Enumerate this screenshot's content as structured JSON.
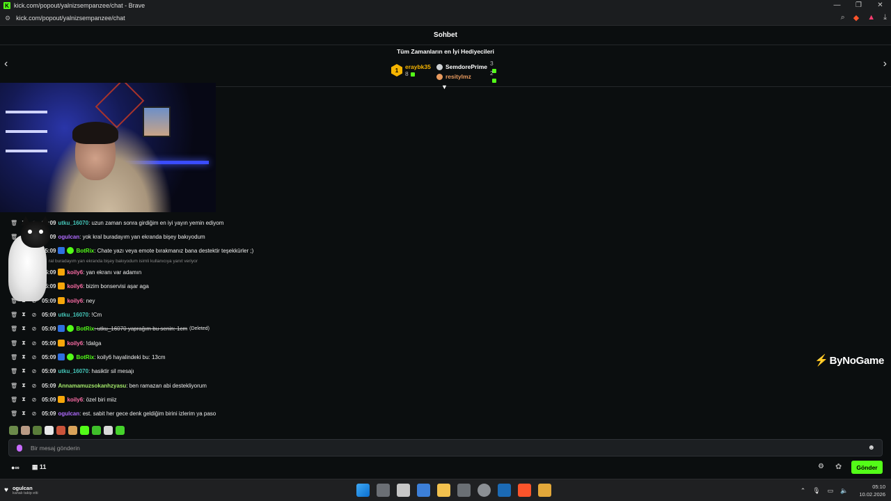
{
  "browser": {
    "title": "kick.com/popout/yalnizsempanzee/chat - Brave",
    "url": "kick.com/popout/yalnizsempanzee/chat"
  },
  "chat": {
    "header": "Sohbet",
    "gifters_title": "Tüm Zamanların en İyi Hediyecileri",
    "gifters": [
      {
        "rank": "1",
        "name": "eraybk35",
        "count": "8"
      },
      {
        "name": "SemdorePrime",
        "count": "3"
      },
      {
        "name": "resitylmz",
        "count": "2"
      }
    ],
    "reply_text": "ral buradayım yan ekranda bişey bakıyodum isimli kullanıcıya yanıt veriyor",
    "messages": [
      {
        "time": "05:09",
        "user": "utku_16070",
        "text": ": uzun zaman sonra girdiğim en iyi yayın yemin ediyom"
      },
      {
        "time": "05:09",
        "user": "ogulcan",
        "text": ": yok kral buradayım yan ekranda bişey bakıyodum"
      },
      {
        "time": "05:09",
        "user": "BotRix",
        "text": ": Chate yazı veya emote bırakmanız bana destektir teşekkürler ;)"
      },
      {
        "time": "05:09",
        "user": "koily6",
        "text": ": yan ekranı var adamın"
      },
      {
        "time": "05:09",
        "user": "koily6",
        "text": ": bizim bonservisi aşar aga"
      },
      {
        "time": "05:09",
        "user": "koily6",
        "text": ": ney"
      },
      {
        "time": "05:09",
        "user": "utku_16070",
        "text": ": !Cm"
      },
      {
        "time": "05:09",
        "user": "BotRix",
        "text": ": utku_16070 yaprağım bu senin: 1cm",
        "tag": "(Deleted)"
      },
      {
        "time": "05:09",
        "user": "koily6",
        "text": ": !dalga"
      },
      {
        "time": "05:09",
        "user": "BotRix",
        "text": ": koily6 hayalindeki bu: 13cm"
      },
      {
        "time": "05:09",
        "user": "utku_16070",
        "text": ": hasiktir sil mesajı"
      },
      {
        "time": "05:09",
        "user": "Annamamuzsokanhzyasu",
        "text": ": ben ramazan abi destekliyorum"
      },
      {
        "time": "05:09",
        "user": "koily6",
        "text": ": özel biri miiz"
      },
      {
        "time": "05:09",
        "user": "ogulcan",
        "text": ": est. sabit her gece denk geldiğim birini izlerim ya paso"
      }
    ],
    "input_placeholder": "Bir mesaj gönderin",
    "viewers": "11",
    "send_label": "Gönder"
  },
  "watermark": "ByNoGame",
  "taskbar": {
    "notif_user": "ogulcan",
    "notif_sub": "kanalı takip etti",
    "time": "05:10",
    "date": "10.02.2026"
  },
  "colors": {
    "accent": "#53fc18"
  }
}
